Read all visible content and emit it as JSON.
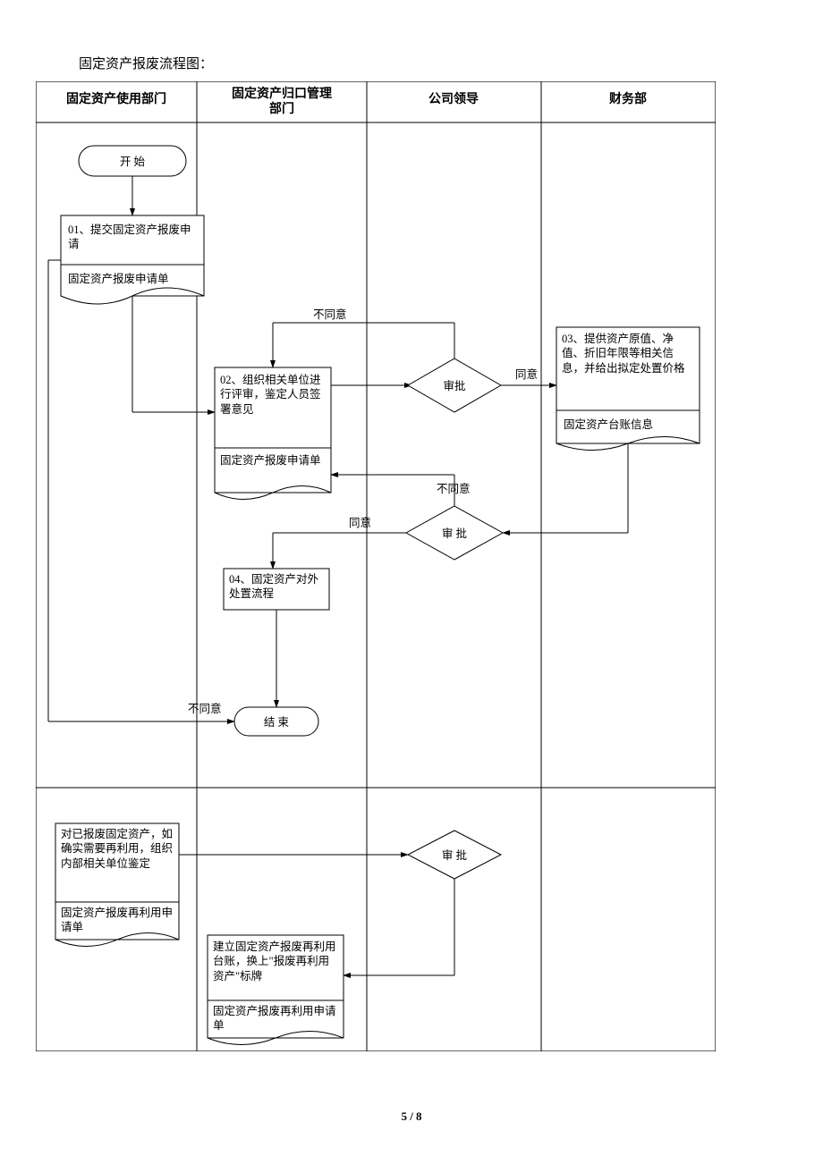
{
  "page_title": "固定资产报废流程图：",
  "footer": "5 / 8",
  "columns": {
    "c1": "固定资产使用部门",
    "c2": "固定资产归口管理部门",
    "c3": "公司领导",
    "c4": "财务部"
  },
  "nodes": {
    "start": "开 始",
    "n01a": "01、提交固定资产报废申请",
    "n01b": "固定资产报废申请单",
    "n02a": "02、组织相关单位进行评审，鉴定人员签署意见",
    "n02b": "固定资产报废申请单",
    "n03a": "03、提供资产原值、净值、折旧年限等相关信息，并给出拟定处置价格",
    "n03b": "固定资产台账信息",
    "d1": "审批",
    "d2": "审 批",
    "n04": "04、固定资产对外处置流程",
    "end": "结 束",
    "r1a": "对已报废固定资产，如确实需要再利用，组织内部相关单位鉴定",
    "r1b": "固定资产报废再利用申请单",
    "d3": "审 批",
    "r2a": "建立固定资产报废再利用台账，换上\"报废再利用资产\"标牌",
    "r2b": "固定资产报废再利用申请单"
  },
  "labels": {
    "agree": "同意",
    "disagree": "不同意"
  }
}
